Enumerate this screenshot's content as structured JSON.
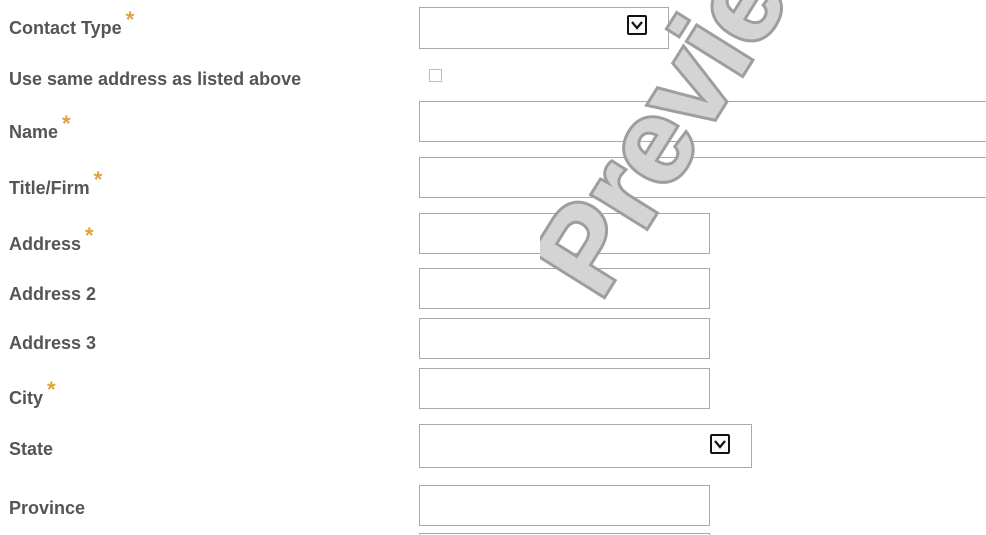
{
  "form": {
    "fields": [
      {
        "key": "contact_type",
        "label": "Contact Type",
        "required": true,
        "type": "select",
        "value": ""
      },
      {
        "key": "same_address",
        "label": "Use same address as listed above",
        "required": false,
        "type": "checkbox",
        "checked": false
      },
      {
        "key": "name",
        "label": "Name",
        "required": true,
        "type": "text",
        "value": ""
      },
      {
        "key": "title_firm",
        "label": "Title/Firm",
        "required": true,
        "type": "text",
        "value": ""
      },
      {
        "key": "address",
        "label": "Address",
        "required": true,
        "type": "text",
        "value": ""
      },
      {
        "key": "address2",
        "label": "Address 2",
        "required": false,
        "type": "text",
        "value": ""
      },
      {
        "key": "address3",
        "label": "Address 3",
        "required": false,
        "type": "text",
        "value": ""
      },
      {
        "key": "city",
        "label": "City",
        "required": true,
        "type": "text",
        "value": ""
      },
      {
        "key": "state",
        "label": "State",
        "required": false,
        "type": "select",
        "value": ""
      },
      {
        "key": "province",
        "label": "Province",
        "required": false,
        "type": "text",
        "value": ""
      }
    ],
    "required_marker": "*"
  },
  "watermark": {
    "text": "Preview",
    "color": "#c8c8c8"
  },
  "colors": {
    "label": "#555555",
    "required": "#e0a23b",
    "border": "#a9a9a9"
  }
}
